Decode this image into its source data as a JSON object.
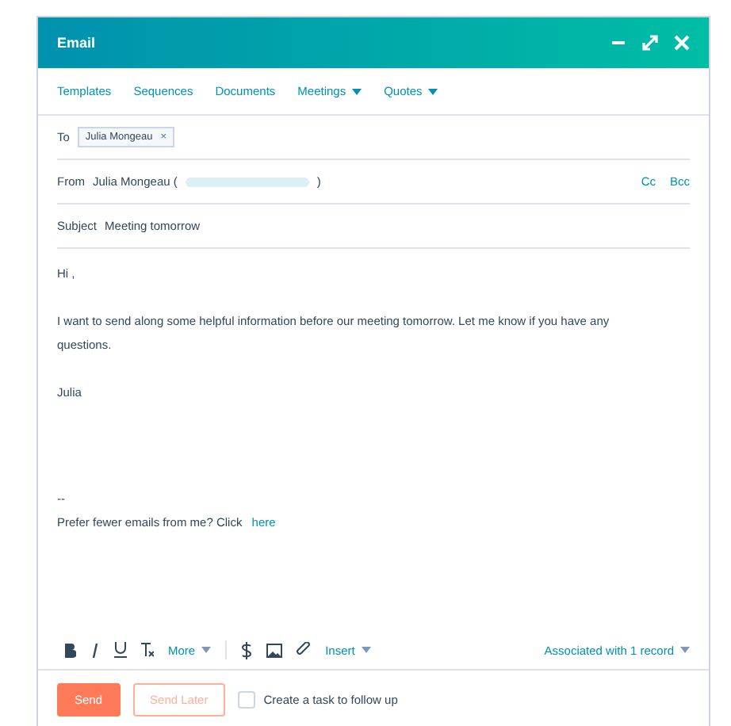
{
  "window": {
    "title": "Email"
  },
  "tabs": [
    {
      "label": "Templates",
      "menu": false
    },
    {
      "label": "Sequences",
      "menu": false
    },
    {
      "label": "Documents",
      "menu": false
    },
    {
      "label": "Meetings",
      "menu": true
    },
    {
      "label": "Quotes",
      "menu": true
    }
  ],
  "to": {
    "label": "To",
    "recipients": [
      {
        "name": "Julia Mongeau",
        "remove": "×"
      }
    ]
  },
  "from": {
    "label": "From",
    "name": "Julia Mongeau (",
    "close": ")",
    "cc": "Cc",
    "bcc": "Bcc"
  },
  "subject": {
    "label": "Subject",
    "value": "Meeting tomorrow"
  },
  "body": {
    "greeting": "Hi ,",
    "paragraph": "I want to send along some helpful information before our meeting tomorrow. Let me know if you have any questions.",
    "signature": "Julia",
    "separator": "--",
    "footer": "Prefer fewer emails from me? Click ",
    "footer_link": "here"
  },
  "toolbar": {
    "more": "More",
    "insert": "Insert",
    "association": "Associated with 1 record"
  },
  "actions": {
    "send": "Send",
    "send_later": "Send Later",
    "task": {
      "label": "Create a task to follow up",
      "checked": false
    }
  }
}
